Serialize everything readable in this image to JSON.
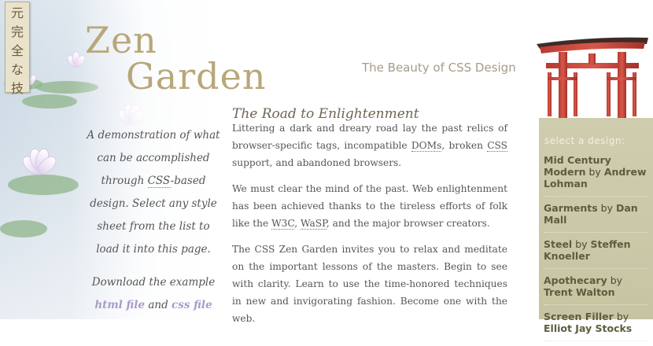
{
  "kanji": [
    "元",
    "完",
    "全",
    "な",
    "技"
  ],
  "header": {
    "title_line1": "Zen",
    "title_line2": "Garden",
    "tagline": "The Beauty of CSS Design"
  },
  "intro": {
    "text_before_abbr": "A demonstration of what can be accomplished through ",
    "abbr": "CSS",
    "text_after_abbr": "-based design. Select any style sheet from the list to load it into this page.",
    "download_prefix": "Download the example ",
    "html_link": "html file",
    "and_text": " and ",
    "css_link": "css file"
  },
  "main": {
    "heading": "The Road to Enlightenment",
    "p1_a": "Littering a dark and dreary road lay the past relics of browser-specific tags, incompatible ",
    "p1_dom": "DOMs",
    "p1_b": ", broken ",
    "p1_css": "CSS",
    "p1_c": " support, and abandoned browsers.",
    "p2_a": "We must clear the mind of the past. Web enlightenment has been achieved thanks to the tireless efforts of folk like the ",
    "p2_w3c": "W3C",
    "p2_b": ", ",
    "p2_wasp": "WaSP",
    "p2_c": ", and the major browser creators.",
    "p3": "The CSS Zen Garden invites you to relax and meditate on the important lessons of the masters. Begin to see with clarity. Learn to use the time-honored techniques in new and invigorating fashion. Become one with the web."
  },
  "designs": {
    "title": "select a design:",
    "by": "by",
    "items": [
      {
        "name": "Mid Century Modern",
        "author": "Andrew Lohman"
      },
      {
        "name": "Garments",
        "author": "Dan Mall"
      },
      {
        "name": "Steel",
        "author": "Steffen Knoeller"
      },
      {
        "name": "Apothecary",
        "author": "Trent Walton"
      },
      {
        "name": "Screen Filler",
        "author": "Elliot Jay Stocks"
      }
    ]
  }
}
